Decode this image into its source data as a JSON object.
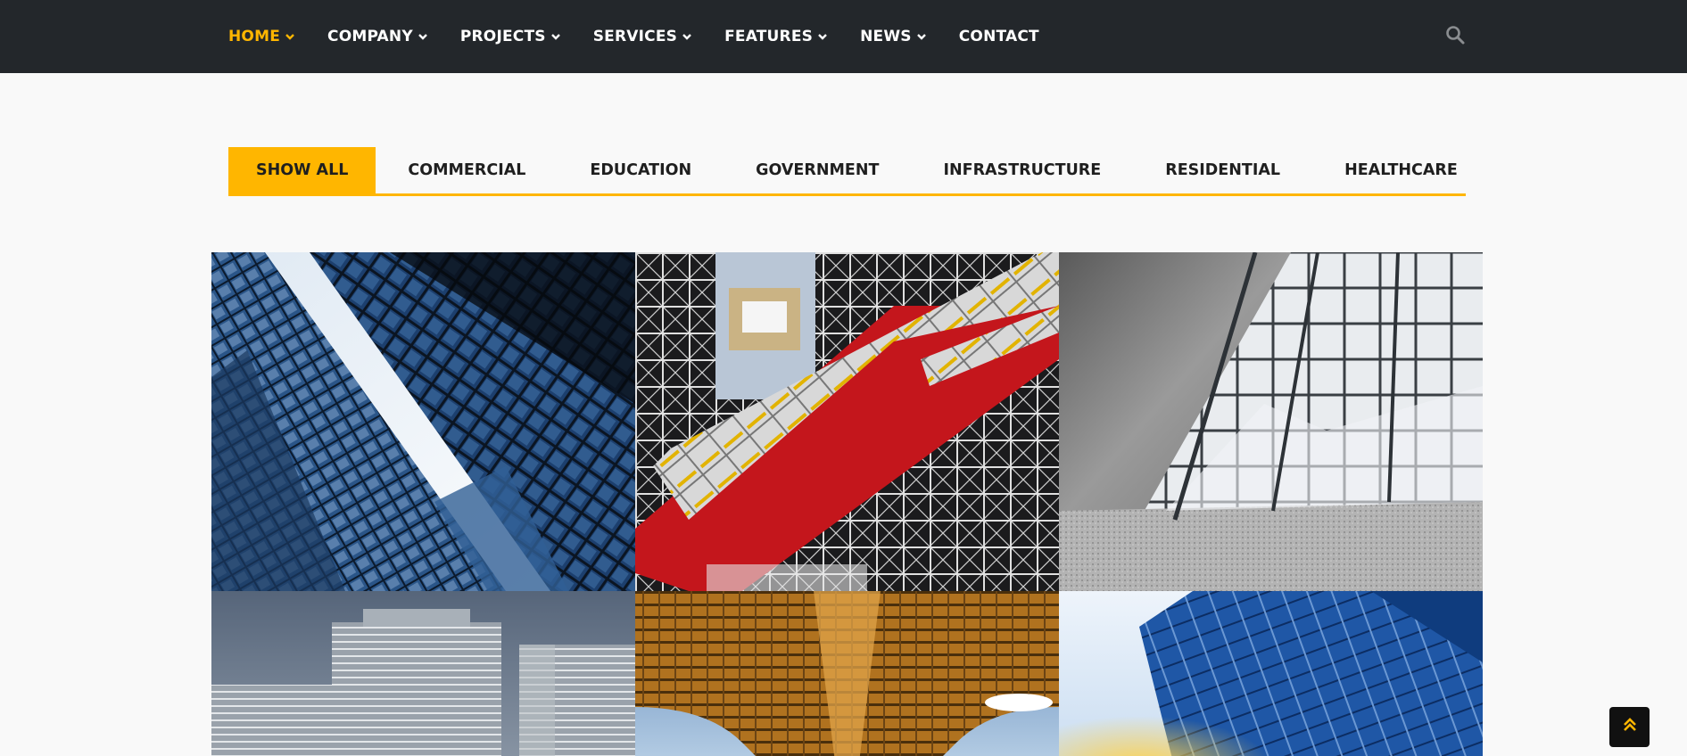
{
  "nav": {
    "items": [
      {
        "label": "HOME",
        "has_dropdown": true,
        "active": true
      },
      {
        "label": "COMPANY",
        "has_dropdown": true,
        "active": false
      },
      {
        "label": "PROJECTS",
        "has_dropdown": true,
        "active": false
      },
      {
        "label": "SERVICES",
        "has_dropdown": true,
        "active": false
      },
      {
        "label": "FEATURES",
        "has_dropdown": true,
        "active": false
      },
      {
        "label": "NEWS",
        "has_dropdown": true,
        "active": false
      },
      {
        "label": "CONTACT",
        "has_dropdown": false,
        "active": false
      }
    ],
    "search_icon": "search-icon"
  },
  "filters": {
    "tabs": [
      {
        "label": "SHOW ALL",
        "active": true
      },
      {
        "label": "COMMERCIAL",
        "active": false
      },
      {
        "label": "EDUCATION",
        "active": false
      },
      {
        "label": "GOVERNMENT",
        "active": false
      },
      {
        "label": "INFRASTRUCTURE",
        "active": false
      },
      {
        "label": "RESIDENTIAL",
        "active": false
      },
      {
        "label": "HEALTHCARE",
        "active": false
      }
    ]
  },
  "projects": [
    {
      "image": "glass-skyscrapers-photo"
    },
    {
      "image": "escalator-tube-building-photo"
    },
    {
      "image": "glass-pavilion-photo"
    },
    {
      "image": "office-towers-photo"
    },
    {
      "image": "bridge-underside-photo"
    },
    {
      "image": "blue-glass-tower-photo"
    }
  ],
  "back_to_top_icon": "double-chevron-up-icon",
  "colors": {
    "accent": "#ffb600",
    "nav_bg": "#23272b",
    "page_bg": "#f9f9f9"
  }
}
